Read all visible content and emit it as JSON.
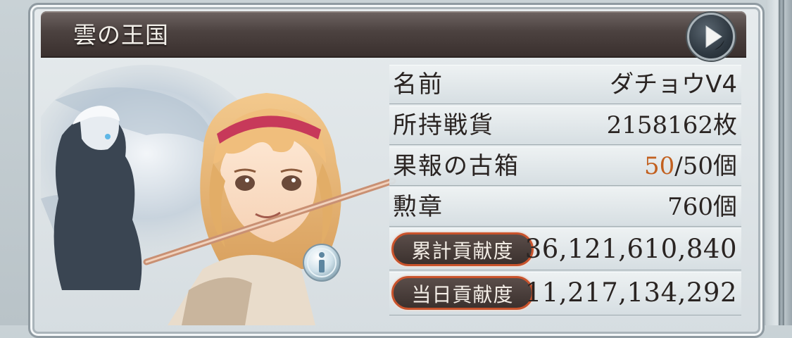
{
  "panel": {
    "title": "雲の王国"
  },
  "rows": {
    "name": {
      "label": "名前",
      "value": "ダチョウV4"
    },
    "spoils": {
      "label": "所持戦貨",
      "value": "2158162",
      "unit": "枚"
    },
    "chests": {
      "label": "果報の古箱",
      "current": "50",
      "max": "/50",
      "unit": "個"
    },
    "medals": {
      "label": "勲章",
      "value": "760",
      "unit": "個"
    },
    "total_contribution": {
      "label": "累計貢献度",
      "value": "36,121,610,840"
    },
    "daily_contribution": {
      "label": "当日貢献度",
      "value": "11,217,134,292"
    }
  },
  "colors": {
    "accent_orange": "#c2601f",
    "pill_border": "#c9532c",
    "title_bar": "#4c4240"
  },
  "icons": {
    "play": "play-triangle-icon",
    "info": "info-icon"
  }
}
